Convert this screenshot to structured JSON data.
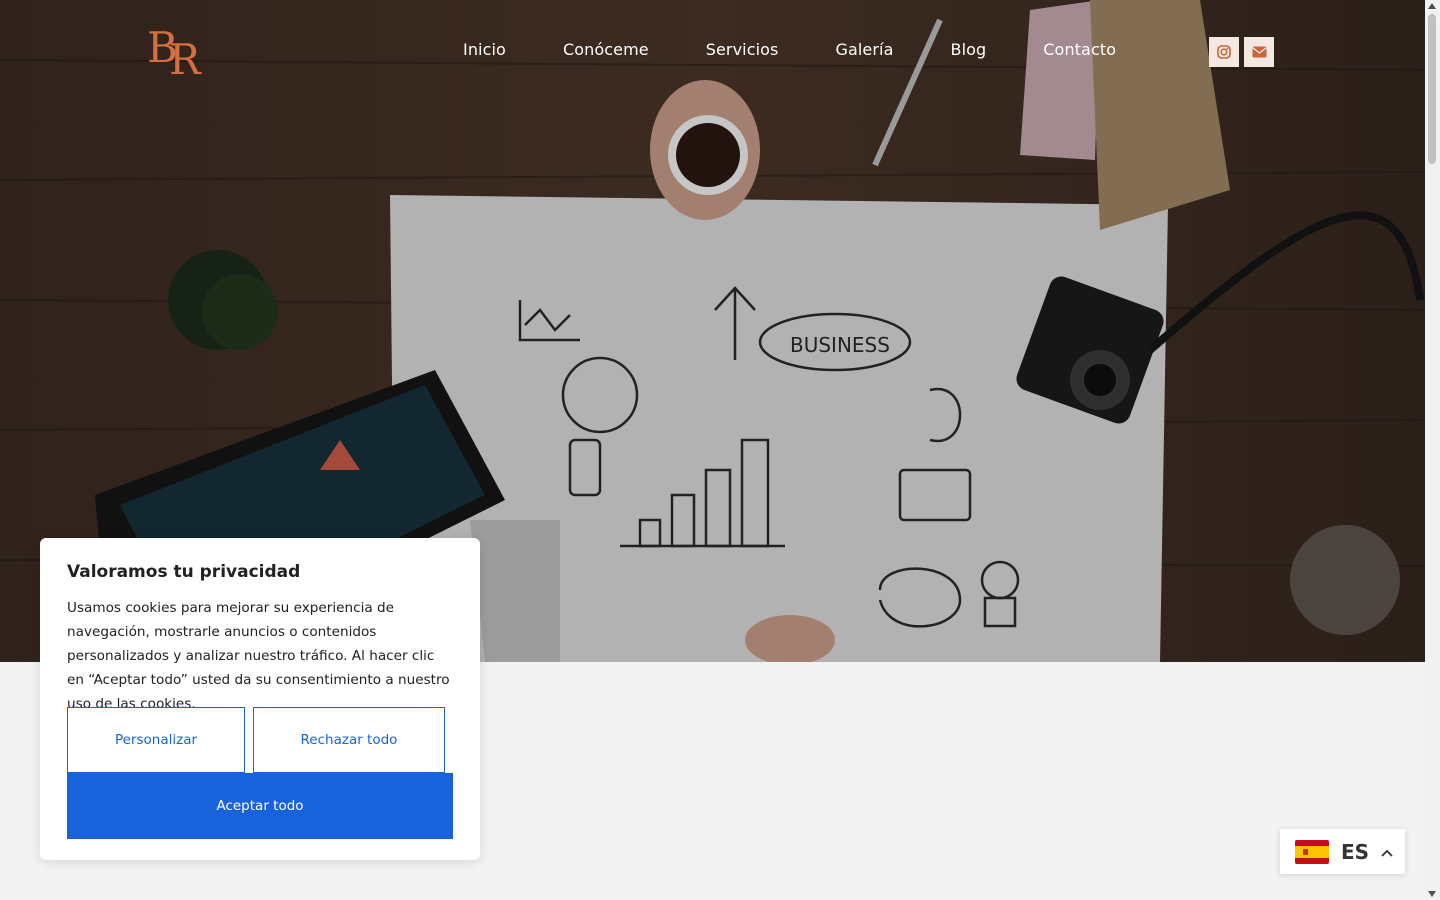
{
  "brand": {
    "logo_text": "BR"
  },
  "nav": {
    "items": [
      "Inicio",
      "Conóceme",
      "Servicios",
      "Galería",
      "Blog",
      "Contacto"
    ]
  },
  "social": {
    "icons": [
      "instagram-icon",
      "envelope-icon"
    ]
  },
  "colors": {
    "accent": "#1863dc",
    "logo": "#d4703f",
    "social_bg": "#f4e8e2",
    "social_icon": "#c8643a"
  },
  "cookie": {
    "title": "Valoramos tu privacidad",
    "body": "Usamos cookies para mejorar su experiencia de navegación, mostrarle anuncios o contenidos personalizados y analizar nuestro tráfico. Al hacer clic en “Aceptar todo” usted da su consentimiento a nuestro uso de las cookies.",
    "customize_label": "Personalizar",
    "reject_label": "Rechazar todo",
    "accept_label": "Aceptar todo"
  },
  "language": {
    "code": "ES",
    "flag": "spain-flag-icon"
  }
}
